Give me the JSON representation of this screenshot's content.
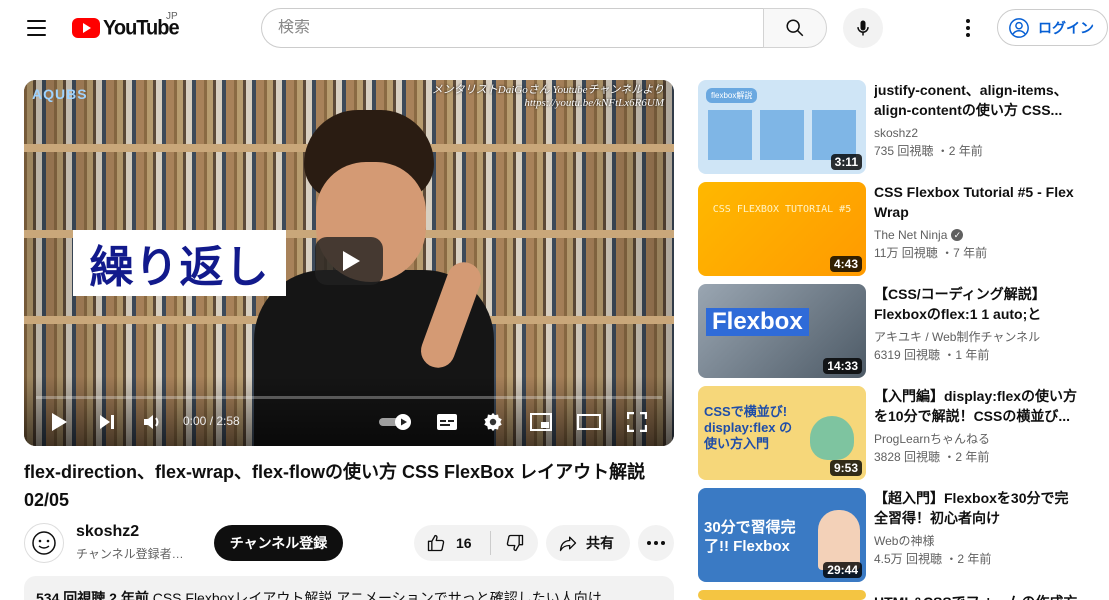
{
  "header": {
    "logo_text": "YouTube",
    "country_code": "JP",
    "search_placeholder": "検索",
    "login_label": "ログイン"
  },
  "player": {
    "overlay_caption": "繰り返し",
    "credit_line1": "メンタリストDaiGoさん Youtubeチャンネルより",
    "credit_line2": "https://youtu.be/kNFtLx6R6UM",
    "channel_watermark": "AQUBS",
    "time_display": "0:00 / 2:58",
    "progress_fraction": 0.0
  },
  "video": {
    "title": "flex-direction、flex-wrap、flex-flowの使い方 CSS FlexBox レイアウト解説 02/05",
    "channel_name": "skoshz2",
    "subscribers": "チャンネル登録者数 ...",
    "subscribe_label": "チャンネル登録",
    "like_count": "16",
    "share_label": "共有",
    "description_stats": "534 回視聴  2 年前",
    "description_text": "CSS Flexboxレイアウト解説 アニメーションでサっと確認したい人向け"
  },
  "recommendations": [
    {
      "title": "justify-conent、align-items、align-contentの使い方 CSS...",
      "channel": "skoshz2",
      "verified": false,
      "stats": "735 回視聴 ・2 年前",
      "duration": "3:11",
      "thumb_text": "flexbox解説"
    },
    {
      "title": "CSS Flexbox Tutorial #5 - Flex Wrap",
      "channel": "The Net Ninja",
      "verified": true,
      "stats": "11万 回視聴 ・7 年前",
      "duration": "4:43",
      "thumb_text": "CSS FLEXBOX TUTORIAL #5"
    },
    {
      "title": "【CSS/コーディング解説】Flexboxのflex:1 1 auto;とは？...",
      "channel": "アキユキ / Web制作チャンネル",
      "verified": false,
      "stats": "6319 回視聴 ・1 年前",
      "duration": "14:33",
      "thumb_text": "Flexbox"
    },
    {
      "title": "【入門編】display:flexの使い方を10分で解説！CSSの横並び...",
      "channel": "ProgLearnちゃんねる",
      "verified": false,
      "stats": "3828 回視聴 ・2 年前",
      "duration": "9:53",
      "thumb_text": "CSSで横並び! display:flex の使い方入門"
    },
    {
      "title": "【超入門】Flexboxを30分で完全習得！初心者向け 【HTML・...",
      "channel": "Webの神様",
      "verified": false,
      "stats": "4.5万 回視聴 ・2 年前",
      "duration": "29:44",
      "thumb_text": "30分で習得完了!! Flexbox"
    },
    {
      "title": "HTML&CSSでフォームの作成方",
      "channel": "",
      "verified": false,
      "stats": "",
      "duration": "",
      "thumb_text": ""
    }
  ]
}
